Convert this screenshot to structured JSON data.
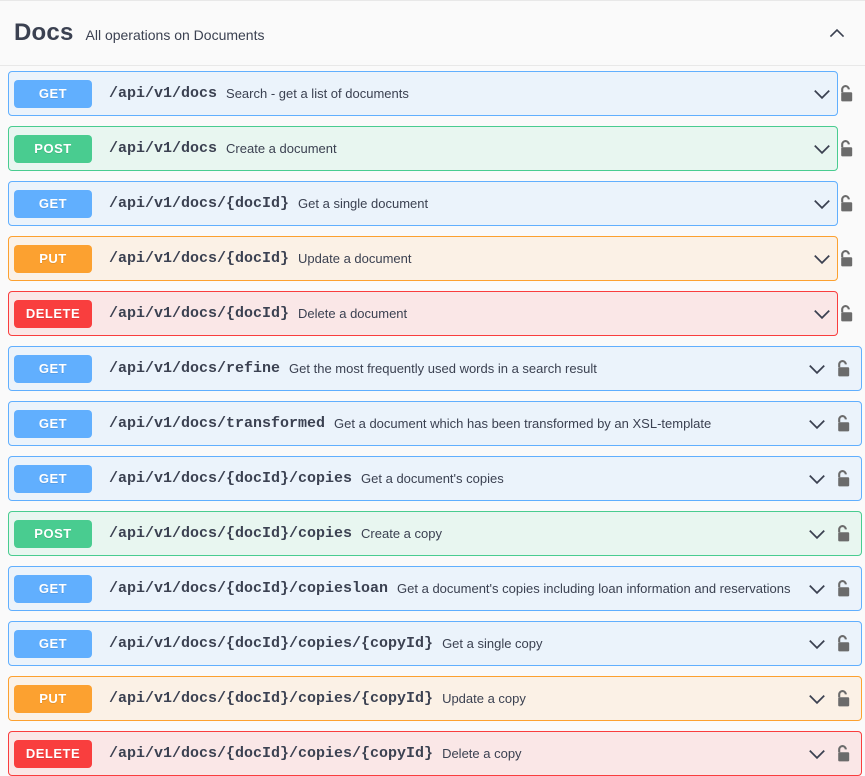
{
  "tag": {
    "title": "Docs",
    "description": "All operations on Documents",
    "toggle_icon": "chevron-up-icon",
    "expanded": true
  },
  "icons": {
    "expand": "chevron-down-icon",
    "lock": "unlocked-padlock-icon"
  },
  "colors": {
    "get": "#61affe",
    "post": "#49cc90",
    "put": "#fca130",
    "delete": "#f93e3e",
    "get_bg": "#ebf3fb",
    "post_bg": "#e8f6f0",
    "put_bg": "#fbf1e6",
    "delete_bg": "#fae7e7",
    "page_bg": "#fafafa",
    "text": "#3b4151",
    "lock": "#6b6b6b"
  },
  "operations": [
    {
      "method": "GET",
      "path": "/api/v1/docs",
      "summary": "Search - get a list of documents",
      "width": "narrow"
    },
    {
      "method": "POST",
      "path": "/api/v1/docs",
      "summary": "Create a document",
      "width": "narrow"
    },
    {
      "method": "GET",
      "path": "/api/v1/docs/{docId}",
      "summary": "Get a single document",
      "width": "narrow"
    },
    {
      "method": "PUT",
      "path": "/api/v1/docs/{docId}",
      "summary": "Update a document",
      "width": "narrow"
    },
    {
      "method": "DELETE",
      "path": "/api/v1/docs/{docId}",
      "summary": "Delete a document",
      "width": "narrow"
    },
    {
      "method": "GET",
      "path": "/api/v1/docs/refine",
      "summary": "Get the most frequently used words in a search result",
      "width": "wide"
    },
    {
      "method": "GET",
      "path": "/api/v1/docs/transformed",
      "summary": "Get a document which has been transformed by an XSL-template",
      "width": "wide"
    },
    {
      "method": "GET",
      "path": "/api/v1/docs/{docId}/copies",
      "summary": "Get a document's copies",
      "width": "wide"
    },
    {
      "method": "POST",
      "path": "/api/v1/docs/{docId}/copies",
      "summary": "Create a copy",
      "width": "wide"
    },
    {
      "method": "GET",
      "path": "/api/v1/docs/{docId}/copiesloan",
      "summary": "Get a document's copies including loan information and reservations",
      "width": "wide"
    },
    {
      "method": "GET",
      "path": "/api/v1/docs/{docId}/copies/{copyId}",
      "summary": "Get a single copy",
      "width": "wide"
    },
    {
      "method": "PUT",
      "path": "/api/v1/docs/{docId}/copies/{copyId}",
      "summary": "Update a copy",
      "width": "wide"
    },
    {
      "method": "DELETE",
      "path": "/api/v1/docs/{docId}/copies/{copyId}",
      "summary": "Delete a copy",
      "width": "wide"
    }
  ]
}
